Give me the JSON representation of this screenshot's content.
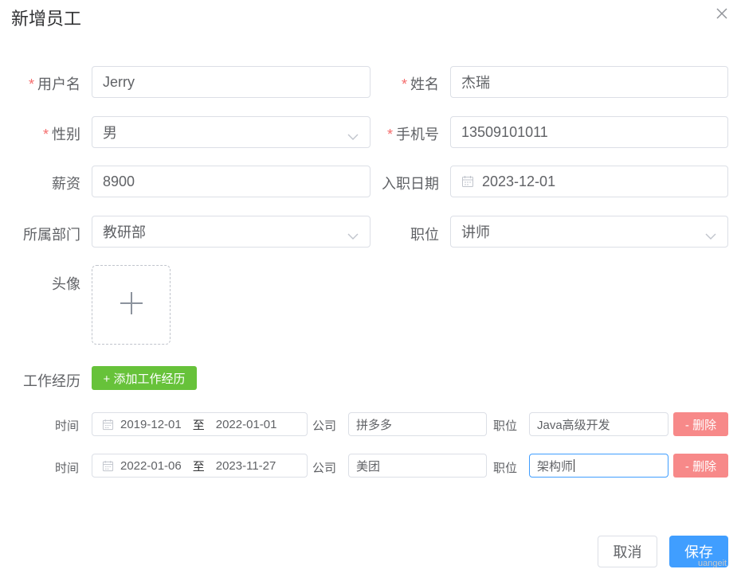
{
  "dialog": {
    "title": "新增员工"
  },
  "form": {
    "username": {
      "label": "用户名",
      "value": "Jerry"
    },
    "name": {
      "label": "姓名",
      "value": "杰瑞"
    },
    "gender": {
      "label": "性别",
      "value": "男"
    },
    "phone": {
      "label": "手机号",
      "value": "13509101011"
    },
    "salary": {
      "label": "薪资",
      "value": "8900"
    },
    "entry_date": {
      "label": "入职日期",
      "value": "2023-12-01"
    },
    "department": {
      "label": "所属部门",
      "value": "教研部"
    },
    "position": {
      "label": "职位",
      "value": "讲师"
    },
    "avatar": {
      "label": "头像"
    },
    "required_mark": "*"
  },
  "work_experience": {
    "label": "工作经历",
    "add_button": "+ 添加工作经历",
    "time_label": "时间",
    "range_separator": "至",
    "company_label": "公司",
    "job_label": "职位",
    "delete_button": "- 删除",
    "items": [
      {
        "start": "2019-12-01",
        "end": "2022-01-01",
        "company": "拼多多",
        "job": "Java高级开发"
      },
      {
        "start": "2022-01-06",
        "end": "2023-11-27",
        "company": "美团",
        "job": "架构师"
      }
    ]
  },
  "footer": {
    "cancel": "取消",
    "save": "保存"
  },
  "watermark": "uangeit",
  "colors": {
    "primary": "#409eff",
    "success": "#67c23a",
    "danger": "#f78989",
    "required": "#f56c6c"
  }
}
